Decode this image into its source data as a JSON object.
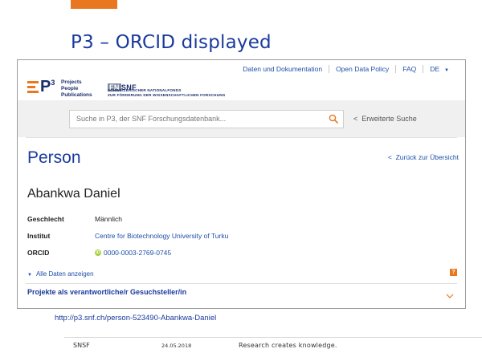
{
  "slide": {
    "title": "P3 – ORCID displayed",
    "url": "http://p3.snf.ch/person-523490-Abankwa-Daniel",
    "footer": {
      "org": "SNSF",
      "date": "24.05.2018",
      "slogan": "Research creates knowledge."
    },
    "accent_color": "#e8771f"
  },
  "site": {
    "topnav": {
      "data_doc": "Daten und Dokumentation",
      "open_data": "Open Data Policy",
      "faq": "FAQ",
      "lang": "DE"
    },
    "p3_logo": {
      "mark": "P",
      "sup": "3",
      "line1": "Projects",
      "line2": "People",
      "line3": "Publications"
    },
    "snf_logo": {
      "fn": "FN",
      "snf": "SNF",
      "line1": "SCHWEIZERISCHER NATIONALFONDS",
      "line2": "ZUR FÖRDERUNG DER WISSENSCHAFTLICHEN FORSCHUNG"
    },
    "search": {
      "placeholder": "Suche in P3, der SNF Forschungsdatenbank...",
      "advanced": "Erweiterte Suche"
    },
    "page_heading": "Person",
    "back_link": "Zurück zur Übersicht",
    "person_name": "Abankwa Daniel",
    "fields": {
      "gender_label": "Geschlecht",
      "gender_value": "Männlich",
      "institute_label": "Institut",
      "institute_value": "Centre for Biotechnology University of Turku",
      "orcid_label": "ORCID",
      "orcid_value": "0000-0003-2769-0745"
    },
    "show_all": "Alle Daten anzeigen",
    "help": "?",
    "projects_heading": "Projekte als verantwortliche/r Gesuchsteller/in"
  }
}
